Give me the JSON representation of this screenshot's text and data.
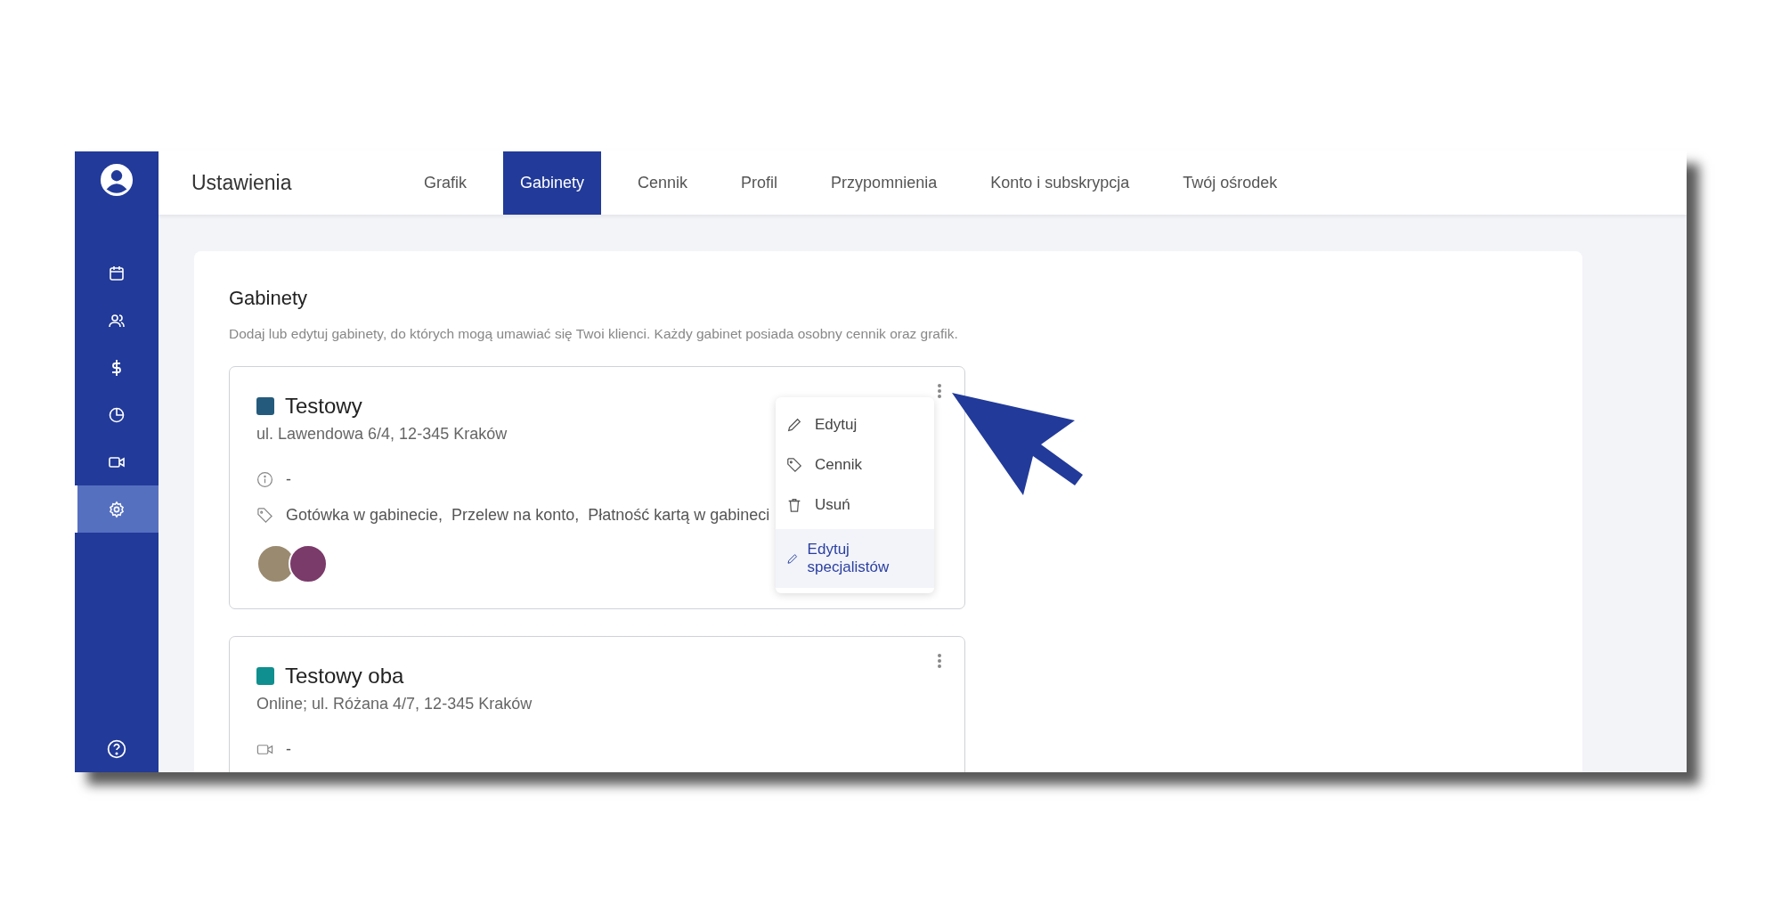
{
  "sidebar": {
    "items": [
      {
        "kind": "calendar",
        "selected": false
      },
      {
        "kind": "users",
        "selected": false
      },
      {
        "kind": "dollar",
        "selected": false
      },
      {
        "kind": "pie",
        "selected": false
      },
      {
        "kind": "video",
        "selected": false
      },
      {
        "kind": "gear",
        "selected": true
      }
    ]
  },
  "header": {
    "title": "Ustawienia",
    "tabs": [
      {
        "label": "Grafik",
        "selected": false
      },
      {
        "label": "Gabinety",
        "selected": true
      },
      {
        "label": "Cennik",
        "selected": false
      },
      {
        "label": "Profil",
        "selected": false
      },
      {
        "label": "Przypomnienia",
        "selected": false
      },
      {
        "label": "Konto i subskrypcja",
        "selected": false
      },
      {
        "label": "Twój ośrodek",
        "selected": false
      }
    ]
  },
  "section": {
    "title": "Gabinety",
    "description": "Dodaj lub edytuj gabinety, do których mogą umawiać się Twoi klienci. Każdy gabinet posiada osobny cennik oraz grafik.",
    "cards": [
      {
        "name": "Testowy",
        "color": "#245b7d",
        "address": "ul. Lawendowa 6/4, 12-345 Kraków",
        "rows": [
          {
            "kind": "info",
            "text": "-"
          },
          {
            "kind": "payments",
            "text": "Gotówka w gabinecie,  Przelew na konto,  Płatność kartą w gabineci"
          }
        ],
        "specialists": [
          {
            "kind": "photo"
          },
          {
            "kind": "photo"
          }
        ],
        "menu": {
          "items": [
            {
              "kind": "pencil",
              "label": "Edytuj",
              "selected": false
            },
            {
              "kind": "tag",
              "label": "Cennik",
              "selected": false
            },
            {
              "kind": "trash",
              "label": "Usuń",
              "selected": false
            },
            {
              "kind": "pencil",
              "label": "Edytuj specjalistów",
              "selected": true
            }
          ]
        }
      },
      {
        "name": "Testowy oba",
        "color": "#0f8f8f",
        "address": "Online; ul. Różana 4/7, 12-345 Kraków",
        "rows": [
          {
            "kind": "video",
            "text": "-"
          }
        ]
      }
    ]
  }
}
